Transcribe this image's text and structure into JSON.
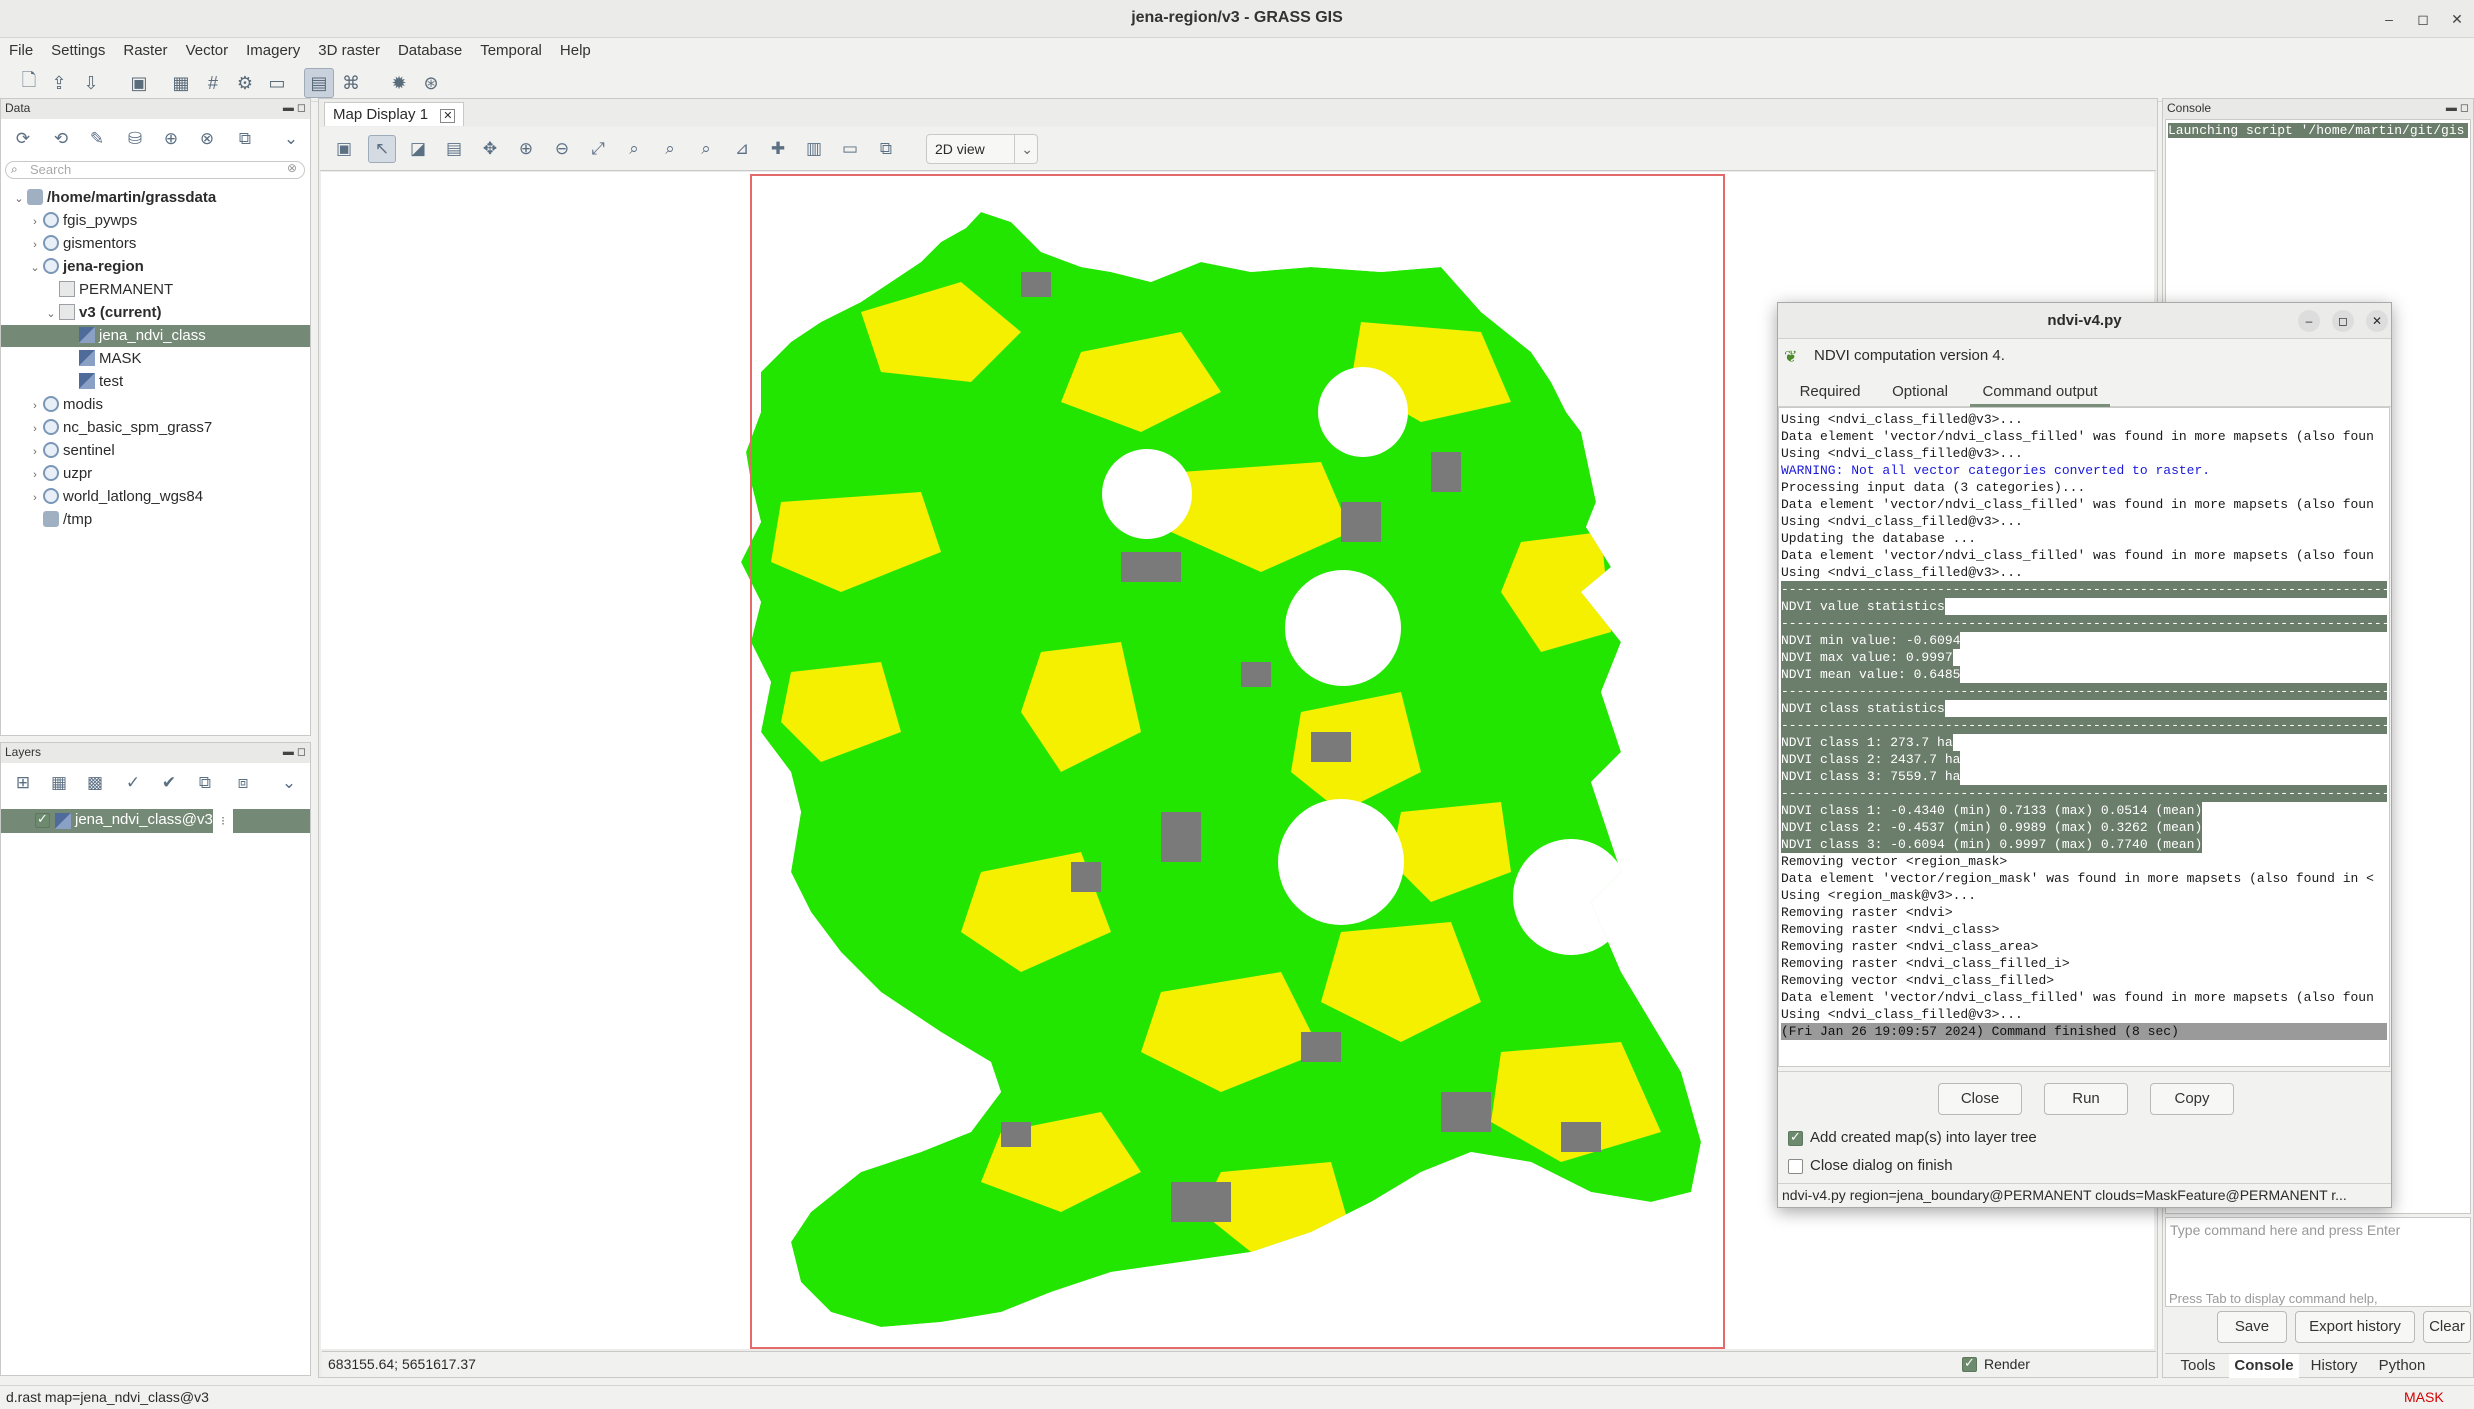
{
  "window": {
    "title": "jena-region/v3 - GRASS GIS"
  },
  "menu": [
    "File",
    "Settings",
    "Raster",
    "Vector",
    "Imagery",
    "3D raster",
    "Database",
    "Temporal",
    "Help"
  ],
  "data_panel": {
    "title": "Data",
    "search_placeholder": "Search",
    "tree": [
      {
        "label": "/home/martin/grassdata",
        "bold": true
      },
      {
        "label": "fgis_pywps"
      },
      {
        "label": "gismentors"
      },
      {
        "label": "jena-region",
        "bold": true
      },
      {
        "label": "PERMANENT"
      },
      {
        "label": "v3  (current)",
        "bold": true
      },
      {
        "label": "jena_ndvi_class",
        "selected": true
      },
      {
        "label": "MASK"
      },
      {
        "label": "test"
      },
      {
        "label": "modis"
      },
      {
        "label": "nc_basic_spm_grass7"
      },
      {
        "label": "sentinel"
      },
      {
        "label": "uzpr"
      },
      {
        "label": "world_latlong_wgs84"
      },
      {
        "label": "/tmp"
      }
    ]
  },
  "layers_panel": {
    "title": "Layers",
    "layer": "jena_ndvi_class@v3"
  },
  "map_display": {
    "tab": "Map Display 1",
    "view_mode": "2D view",
    "coords": "683155.64; 5651617.37",
    "render_label": "Render"
  },
  "console_panel": {
    "title": "Console",
    "launch_text": "Launching script '/home/martin/git/gis",
    "command_placeholder": "Type command here and press Enter",
    "hint": "Press Tab to display command help,",
    "buttons": {
      "save": "Save",
      "export": "Export history",
      "clear": "Clear"
    },
    "tabs": [
      "Tools",
      "Console",
      "History",
      "Python"
    ],
    "active_tab": "Console"
  },
  "dialog": {
    "title": "ndvi-v4.py",
    "description": "NDVI computation version 4.",
    "tabs": [
      "Required",
      "Optional",
      "Command output"
    ],
    "active_tab": "Command output",
    "output": [
      {
        "t": "Using <ndvi_class_filled@v3>..."
      },
      {
        "t": "Data element 'vector/ndvi_class_filled' was found in more mapsets (also foun"
      },
      {
        "t": "Using <ndvi_class_filled@v3>..."
      },
      {
        "t": "WARNING: Not all vector categories converted to raster.",
        "k": "warn"
      },
      {
        "t": "Processing input data (3 categories)..."
      },
      {
        "t": "Data element 'vector/ndvi_class_filled' was found in more mapsets (also foun"
      },
      {
        "t": "Using <ndvi_class_filled@v3>..."
      },
      {
        "t": "Updating the database ..."
      },
      {
        "t": "Data element 'vector/ndvi_class_filled' was found in more mapsets (also foun"
      },
      {
        "t": "Using <ndvi_class_filled@v3>..."
      },
      {
        "t": "--------------------------------------------------------------------------------",
        "k": "hl"
      },
      {
        "t": "NDVI value statistics",
        "k": "hl"
      },
      {
        "t": "--------------------------------------------------------------------------------",
        "k": "hl"
      },
      {
        "t": "NDVI min value: -0.6094",
        "k": "hl"
      },
      {
        "t": "NDVI max value: 0.9997",
        "k": "hl"
      },
      {
        "t": "NDVI mean value: 0.6485",
        "k": "hl"
      },
      {
        "t": "--------------------------------------------------------------------------------",
        "k": "hl"
      },
      {
        "t": "NDVI class statistics",
        "k": "hl"
      },
      {
        "t": "--------------------------------------------------------------------------------",
        "k": "hl"
      },
      {
        "t": "NDVI class 1: 273.7 ha",
        "k": "hl"
      },
      {
        "t": "NDVI class 2: 2437.7 ha",
        "k": "hl"
      },
      {
        "t": "NDVI class 3: 7559.7 ha",
        "k": "hl"
      },
      {
        "t": "--------------------------------------------------------------------------------",
        "k": "hl"
      },
      {
        "t": "NDVI class 1: -0.4340 (min) 0.7133 (max) 0.0514 (mean)",
        "k": "hl"
      },
      {
        "t": "NDVI class 2: -0.4537 (min) 0.9989 (max) 0.3262 (mean)",
        "k": "hl"
      },
      {
        "t": "NDVI class 3: -0.6094 (min) 0.9997 (max) 0.7740 (mean)",
        "k": "hl"
      },
      {
        "t": "Removing vector <region_mask>"
      },
      {
        "t": "Data element 'vector/region_mask' was found in more mapsets (also found in <"
      },
      {
        "t": "Using <region_mask@v3>..."
      },
      {
        "t": "Removing raster <ndvi>"
      },
      {
        "t": "Removing raster <ndvi_class>"
      },
      {
        "t": "Removing raster <ndvi_class_area>"
      },
      {
        "t": "Removing raster <ndvi_class_filled_i>"
      },
      {
        "t": "Removing vector <ndvi_class_filled>"
      },
      {
        "t": "Data element 'vector/ndvi_class_filled' was found in more mapsets (also foun"
      },
      {
        "t": "Using <ndvi_class_filled@v3>..."
      },
      {
        "t": "(Fri Jan 26 19:09:57 2024) Command finished (8 sec)",
        "k": "fin"
      }
    ],
    "buttons": {
      "close": "Close",
      "run": "Run",
      "copy": "Copy"
    },
    "check_add": "Add created map(s) into layer tree",
    "check_close": "Close dialog on finish",
    "command_line": "ndvi-v4.py region=jena_boundary@PERMANENT clouds=MaskFeature@PERMANENT r..."
  },
  "statusbar": {
    "text": "d.rast map=jena_ndvi_class@v3",
    "mask": "MASK"
  },
  "colors": {
    "green": "#22e600",
    "yellow": "#f5f000",
    "gray": "#7a7a7a",
    "accent": "#758a76"
  }
}
